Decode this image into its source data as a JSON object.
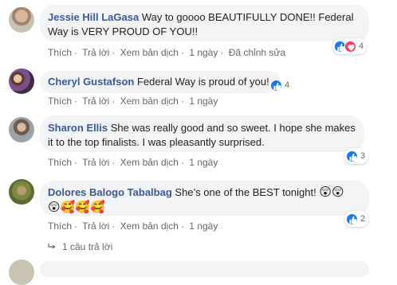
{
  "actions": {
    "like": "Thích",
    "reply": "Trả lời",
    "translate": "Xem bản dịch",
    "time": "1 ngày",
    "edited": "Đã chỉnh sửa"
  },
  "comments": [
    {
      "author": "Jessie Hill LaGasa",
      "text_line1": "Way to goooo BEAUTIFULLY DONE!! Federal",
      "text_line2": "Way is VERY PROUD OF YOU!!",
      "reaction_count": "4",
      "reactions": [
        "like-icon",
        "love-icon"
      ]
    },
    {
      "author": "Cheryl Gustafson",
      "text_line1": "Federal Way is proud of you!",
      "reaction_count": "4",
      "reactions": [
        "like-icon"
      ]
    },
    {
      "author": "Sharon Ellis",
      "text_line1": "She was really good and so sweet. I hope she makes",
      "text_line2": "it to the top finalists. I was pleasantly surprised.",
      "reaction_count": "3",
      "reactions": [
        "like-icon"
      ]
    },
    {
      "author": "Dolores Balogo Tabalbag",
      "text_line1": "She’s one of the BEST tonight!",
      "emoji_line1": "😲😲",
      "emoji_line2": "😲🥰🥰🥰",
      "reaction_count": "2",
      "reactions": [
        "like-icon"
      ]
    }
  ],
  "reply_thread": {
    "label": "1 câu trả lời"
  },
  "colors": {
    "author": "#385898",
    "bubble": "#f2f3f5",
    "meta": "#65676b",
    "like": "#1877f2",
    "love": "#f33e58"
  }
}
